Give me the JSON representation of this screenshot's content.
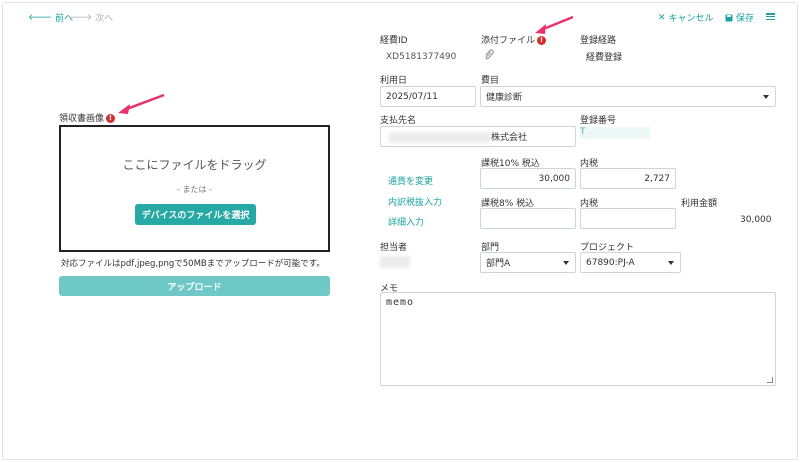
{
  "toolbar": {
    "prev_label": "前へ",
    "next_label": "次へ",
    "cancel_label": "キャンセル",
    "save_label": "保存"
  },
  "left": {
    "receipt_label": "領収書画像",
    "drop_title": "ここにファイルをドラッグ",
    "drop_or": "- または -",
    "select_button": "デバイスのファイルを選択",
    "note": "対応ファイルはpdf,jpeg,pngで50MBまでアップロードが可能です。",
    "upload_button": "アップロード"
  },
  "form": {
    "expense_id_label": "経費ID",
    "expense_id_value": "XD5181377490",
    "attachment_label": "添付ファイル",
    "route_label": "登録経路",
    "route_value": "経費登録",
    "date_label": "利用日",
    "date_value": "2025/07/11",
    "category_label": "費目",
    "category_value": "健康診断",
    "payee_label": "支払先名",
    "payee_value": "株式会社",
    "regno_label": "登録番号",
    "regno_value": "T",
    "currency_link": "通貨を変更",
    "tax_breakdown_link": "内訳税抜入力",
    "detail_link": "詳細入力",
    "tax10_label": "課税10% 税込",
    "tax10_value": "30,000",
    "included_tax_label": "内税",
    "included_tax_value": "2,727",
    "tax8_label": "課税8% 税込",
    "included_tax8_label": "内税",
    "amount_label": "利用金額",
    "amount_value": "30,000",
    "person_label": "担当者",
    "dept_label": "部門",
    "dept_value": "部門A",
    "project_label": "プロジェクト",
    "project_value": "67890:PJ-A",
    "memo_label": "メモ",
    "memo_value": "memo"
  },
  "icons": {
    "prev": "arrow-left-icon",
    "next": "arrow-right-icon",
    "cancel": "close-icon",
    "save": "save-icon",
    "menu": "hamburger-menu-icon",
    "attachment": "paperclip-icon",
    "error": "error-icon"
  },
  "colors": {
    "accent": "#1aa3a0",
    "button": "#26a9a5",
    "upload_button": "#6ec8c6",
    "error": "#d32f2f",
    "annotation_arrow": "#e8336a"
  }
}
